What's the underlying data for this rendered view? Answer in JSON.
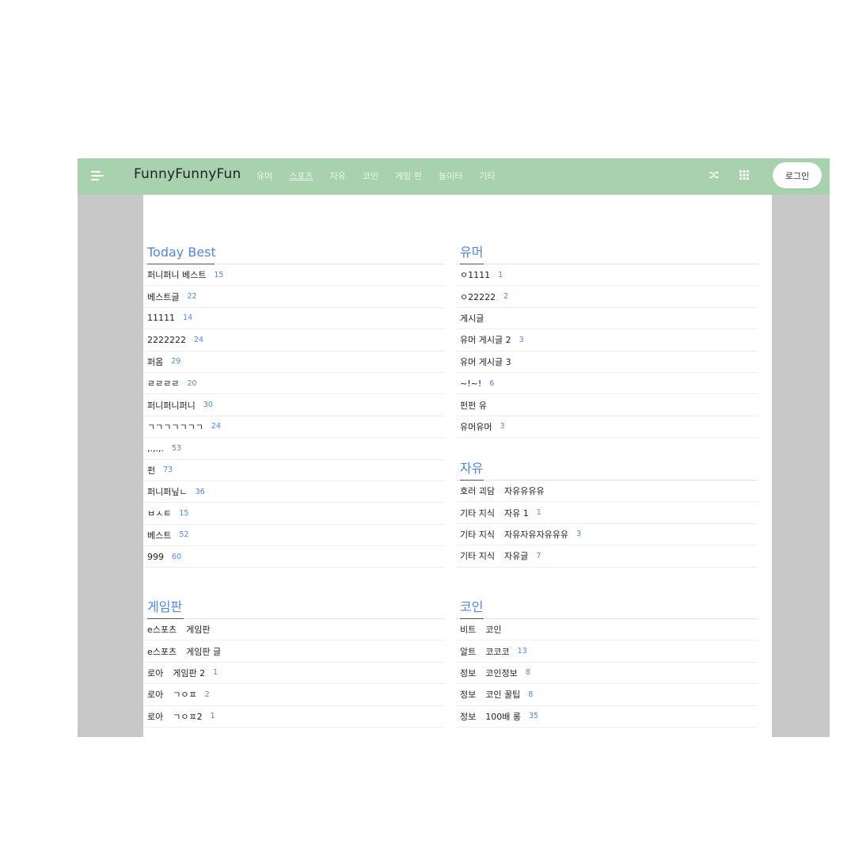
{
  "header": {
    "brand": "FunnyFunnyFun",
    "nav": [
      {
        "label": "유머"
      },
      {
        "label": "스포츠",
        "underline": true
      },
      {
        "label": "자유"
      },
      {
        "label": "코인"
      },
      {
        "label": "게임 판"
      },
      {
        "label": "놀이터"
      },
      {
        "label": "기타"
      }
    ],
    "login_label": "로그인",
    "icons": {
      "menu": "hamburger-menu-icon",
      "shuffle": "shuffle-icon",
      "grid": "grid-apps-icon"
    },
    "colors": {
      "bar": "#a8d2ae",
      "accent": "#4f86ea"
    }
  },
  "sections": {
    "today_best": {
      "title": "Today Best",
      "items": [
        {
          "title": "퍼니퍼니 베스트",
          "count": "15"
        },
        {
          "title": "베스트글",
          "count": "22"
        },
        {
          "title": "11111",
          "count": "14"
        },
        {
          "title": "2222222",
          "count": "24"
        },
        {
          "title": "퍼옴",
          "count": "29"
        },
        {
          "title": "ㄹㄹㄹㄹ",
          "count": "20"
        },
        {
          "title": "퍼니퍼니퍼니",
          "count": "30"
        },
        {
          "title": "ㄱㄱㄱㄱㄱㄱㄱ",
          "count": "24"
        },
        {
          "title": ",.,.,.",
          "count": "53"
        },
        {
          "title": "펀",
          "count": "73"
        },
        {
          "title": "퍼니퍼닢ㄴ",
          "count": "36"
        },
        {
          "title": "ㅂㅅㅌ",
          "count": "15"
        },
        {
          "title": "베스트",
          "count": "52"
        },
        {
          "title": "999",
          "count": "60"
        }
      ]
    },
    "humor": {
      "title": "유머",
      "items": [
        {
          "title": "ㅇ1111",
          "count": "1"
        },
        {
          "title": "ㅇ22222",
          "count": "2"
        },
        {
          "title": "게시글",
          "count": ""
        },
        {
          "title": "유머 게시글 2",
          "count": "3"
        },
        {
          "title": "유머 게시글 3",
          "count": ""
        },
        {
          "title": "~!~!",
          "count": "6"
        },
        {
          "title": "펀펀 유",
          "count": ""
        },
        {
          "title": "유머유머",
          "count": "3"
        }
      ]
    },
    "free": {
      "title": "자유",
      "items": [
        {
          "category": "호러 괴담",
          "title": "자유유유유",
          "count": ""
        },
        {
          "category": "기타 지식",
          "title": "자유 1",
          "count": "1"
        },
        {
          "category": "기타 지식",
          "title": "자유자유자유유유",
          "count": "3"
        },
        {
          "category": "기타 지식",
          "title": "자유글",
          "count": "7"
        }
      ]
    },
    "game": {
      "title": "게임판",
      "items": [
        {
          "category": "e스포츠",
          "title": "게임판",
          "count": ""
        },
        {
          "category": "e스포츠",
          "title": "게임판 글",
          "count": ""
        },
        {
          "category": "로아",
          "title": "게임판 2",
          "count": "1"
        },
        {
          "category": "로아",
          "title": "ㄱㅇㅍ",
          "count": "2"
        },
        {
          "category": "로아",
          "title": "ㄱㅇㅍ2",
          "count": "1"
        }
      ]
    },
    "coin": {
      "title": "코인",
      "items": [
        {
          "category": "비트",
          "title": "코인",
          "count": ""
        },
        {
          "category": "알트",
          "title": "코코코",
          "count": "13"
        },
        {
          "category": "정보",
          "title": "코인정보",
          "count": "8"
        },
        {
          "category": "정보",
          "title": "코인 꿀팁",
          "count": "8"
        },
        {
          "category": "정보",
          "title": "100배 롱",
          "count": "35"
        }
      ]
    }
  }
}
